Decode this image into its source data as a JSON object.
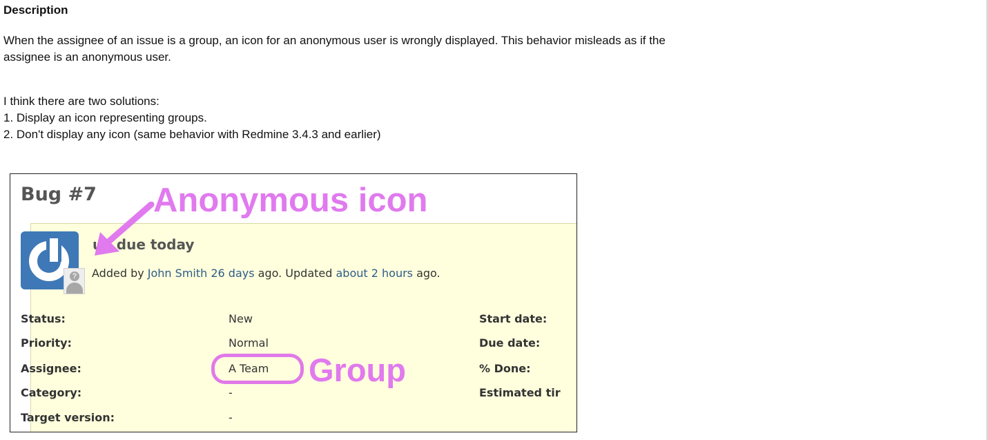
{
  "description": {
    "heading": "Description",
    "paragraph1_line1": "When the assignee of an issue is a group, an icon for an anonymous user is wrongly displayed. This behavior misleads as if the",
    "paragraph1_line2": "assignee is an anonymous user.",
    "paragraph2_line1": "I think there are two solutions:",
    "paragraph2_line2": "1. Display an icon representing groups.",
    "paragraph2_line3": "2. Don't display any icon (same behavior with Redmine 3.4.3 and earlier)"
  },
  "screenshot": {
    "issue_title": "Bug #7",
    "subject": "ue due today",
    "author_prefix": "Added by ",
    "author": "John Smith",
    "added_ago": "26 days",
    "updated_text": " ago. Updated ",
    "updated_ago": "about 2 hours",
    "updated_suffix": " ago.",
    "annotation_anonymous": "Anonymous icon",
    "annotation_group": "Group",
    "attributes": [
      {
        "label": "Status:",
        "value": "New"
      },
      {
        "label": "Priority:",
        "value": "Normal"
      },
      {
        "label": "Assignee:",
        "value": "A Team"
      },
      {
        "label": "Category:",
        "value": "-"
      },
      {
        "label": "Target version:",
        "value": "-"
      }
    ],
    "right_attributes": [
      "Start date:",
      "Due date:",
      "% Done:",
      "Estimated tir"
    ],
    "colors": {
      "annotation": "#e07aee",
      "issue_background": "#ffffdd",
      "link": "#2d5c88",
      "avatar": "#3e78b6"
    },
    "icons": [
      "redmine-avatar-icon",
      "anonymous-user-icon",
      "arrow-icon"
    ]
  }
}
